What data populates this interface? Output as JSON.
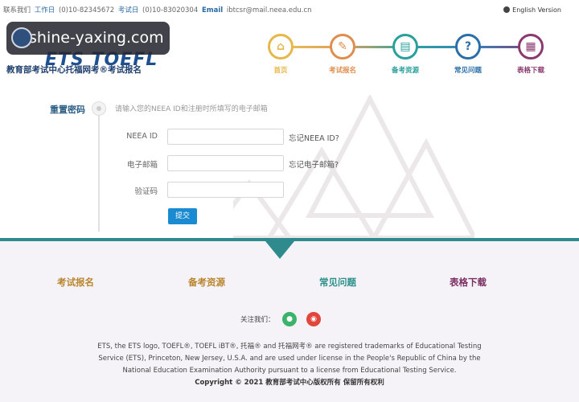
{
  "topbar": {
    "contact_label": "联系我们",
    "workday_label": "工作日",
    "workday_phone": "(0)10-82345672",
    "examday_label": "考试日",
    "examday_phone": "(0)10-83020304",
    "email_label": "Email",
    "email_value": "ibtcsr@mail.neea.edu.cn",
    "language_link": "English Version"
  },
  "header": {
    "watermark_text": "shine-yaxing.com",
    "logo_text": "ETS TOEFL",
    "site_title": "教育部考试中心托福网考®考试报名"
  },
  "nav": {
    "items": [
      {
        "label": "首页",
        "glyph": "⌂",
        "color": "#e6b84a"
      },
      {
        "label": "考试报名",
        "glyph": "✎",
        "color": "#e08d4e"
      },
      {
        "label": "备考资源",
        "glyph": "▤",
        "color": "#2a9f9b"
      },
      {
        "label": "常见问题",
        "glyph": "?",
        "color": "#2b6fa8"
      },
      {
        "label": "表格下载",
        "glyph": "▦",
        "color": "#8b3a70"
      }
    ]
  },
  "form": {
    "section_title": "重置密码",
    "hint": "请输入您的NEEA ID和注册时所填写的电子邮箱",
    "neea_label": "NEEA ID",
    "neea_value": "",
    "neea_link": "忘记NEEA ID?",
    "email_label": "电子邮箱",
    "email_value": "",
    "email_link": "忘记电子邮箱?",
    "captcha_label": "验证码",
    "captcha_value": "",
    "submit": "提交"
  },
  "footer": {
    "nav": [
      {
        "label": "考试报名",
        "color": "#b8862e"
      },
      {
        "label": "备考资源",
        "color": "#b8862e"
      },
      {
        "label": "常见问题",
        "color": "#2b8f8a"
      },
      {
        "label": "表格下载",
        "color": "#7a2f62"
      }
    ],
    "follow_label": "关注我们：",
    "social": [
      {
        "icon": "wechat-icon",
        "glyph": "●",
        "color": "#3bb36a"
      },
      {
        "icon": "weibo-icon",
        "glyph": "◉",
        "color": "#e2463b"
      }
    ],
    "legal_line1": "ETS, the ETS logo, TOEFL®, TOEFL iBT®, 托福® and 托福网考® are registered trademarks of Educational Testing",
    "legal_line2": "Service (ETS), Princeton, New Jersey, U.S.A. and are used under license in the People's Republic of China by the",
    "legal_line3": "National Education Examination Authority pursuant to a license from Educational Testing Service.",
    "copyright": "Copyright © 2021 教育部考试中心版权所有 保留所有权利"
  }
}
